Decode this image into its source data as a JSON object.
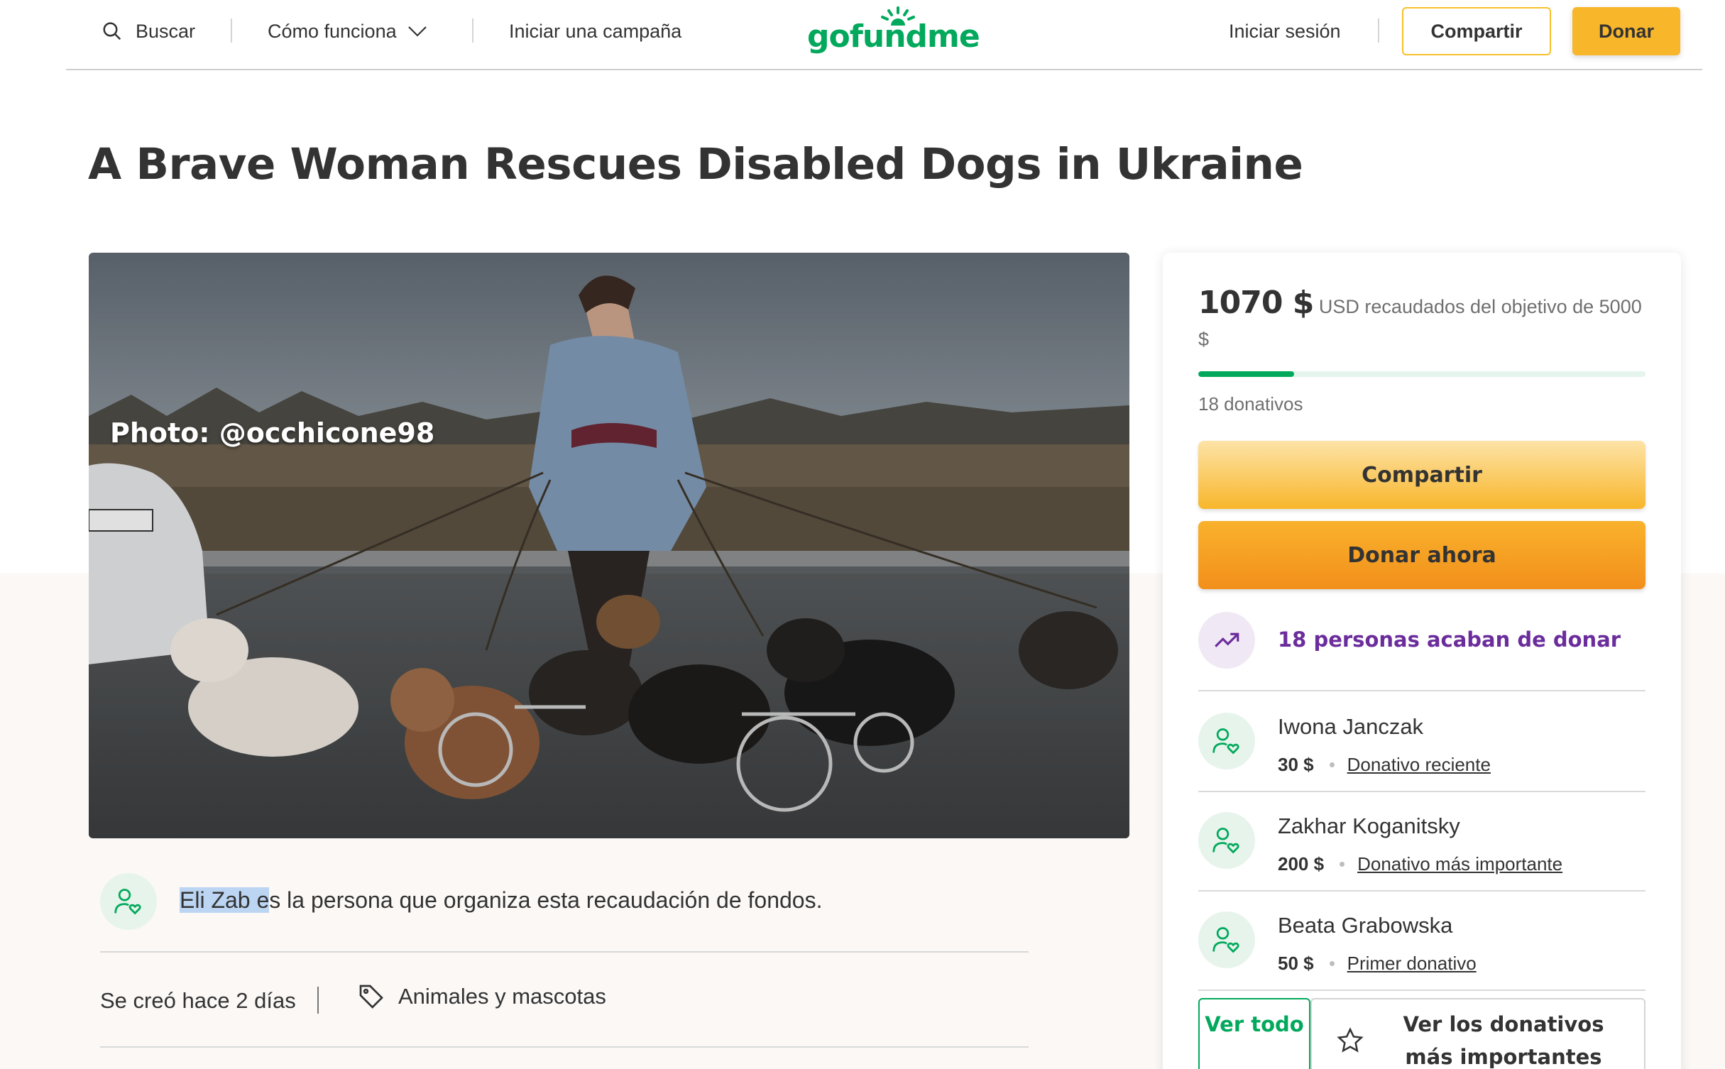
{
  "header": {
    "search_label": "Buscar",
    "how_label": "Cómo funciona",
    "start_label": "Iniciar una campaña",
    "logo_text": "gofundme",
    "login_label": "Iniciar sesión",
    "share_label": "Compartir",
    "donate_label": "Donar"
  },
  "campaign": {
    "title": "A Brave Woman Rescues Disabled Dogs in Ukraine",
    "photo_credit": "Photo: @occhicone98",
    "organizer_name": "Eli Zab",
    "organizer_highlight_suffix": "e",
    "organizer_rest": "s la persona que organiza esta recaudación de fondos.",
    "created": "Se creó hace 2 días",
    "category": "Animales y mascotas"
  },
  "card": {
    "amount": "1070 $",
    "raised_text": "USD recaudados del objetivo de 5000 $",
    "progress_fraction": 0.214,
    "donations_count": "18 donativos",
    "share_button": "Compartir",
    "donate_button": "Donar ahora",
    "recent_text": "18 personas acaban de donar",
    "donors": [
      {
        "name": "Iwona Janczak",
        "amount": "30 $",
        "tag": "Donativo reciente"
      },
      {
        "name": "Zakhar Koganitsky",
        "amount": "200 $",
        "tag": "Donativo más importante"
      },
      {
        "name": "Beata Grabowska",
        "amount": "50 $",
        "tag": "Primer donativo"
      }
    ],
    "see_all_button": "Ver todo",
    "top_donations_button": "Ver los donativos más importantes"
  },
  "colors": {
    "brand_green": "#02a95c",
    "accent_yellow": "#f8b62b",
    "donate_orange": "#f28f1b",
    "recent_purple": "#6b2d9c"
  },
  "icons": [
    "search-icon",
    "chevron-down-icon",
    "sun-logo-icon",
    "trending-up-icon",
    "donor-heart-icon",
    "tag-icon",
    "star-icon"
  ]
}
